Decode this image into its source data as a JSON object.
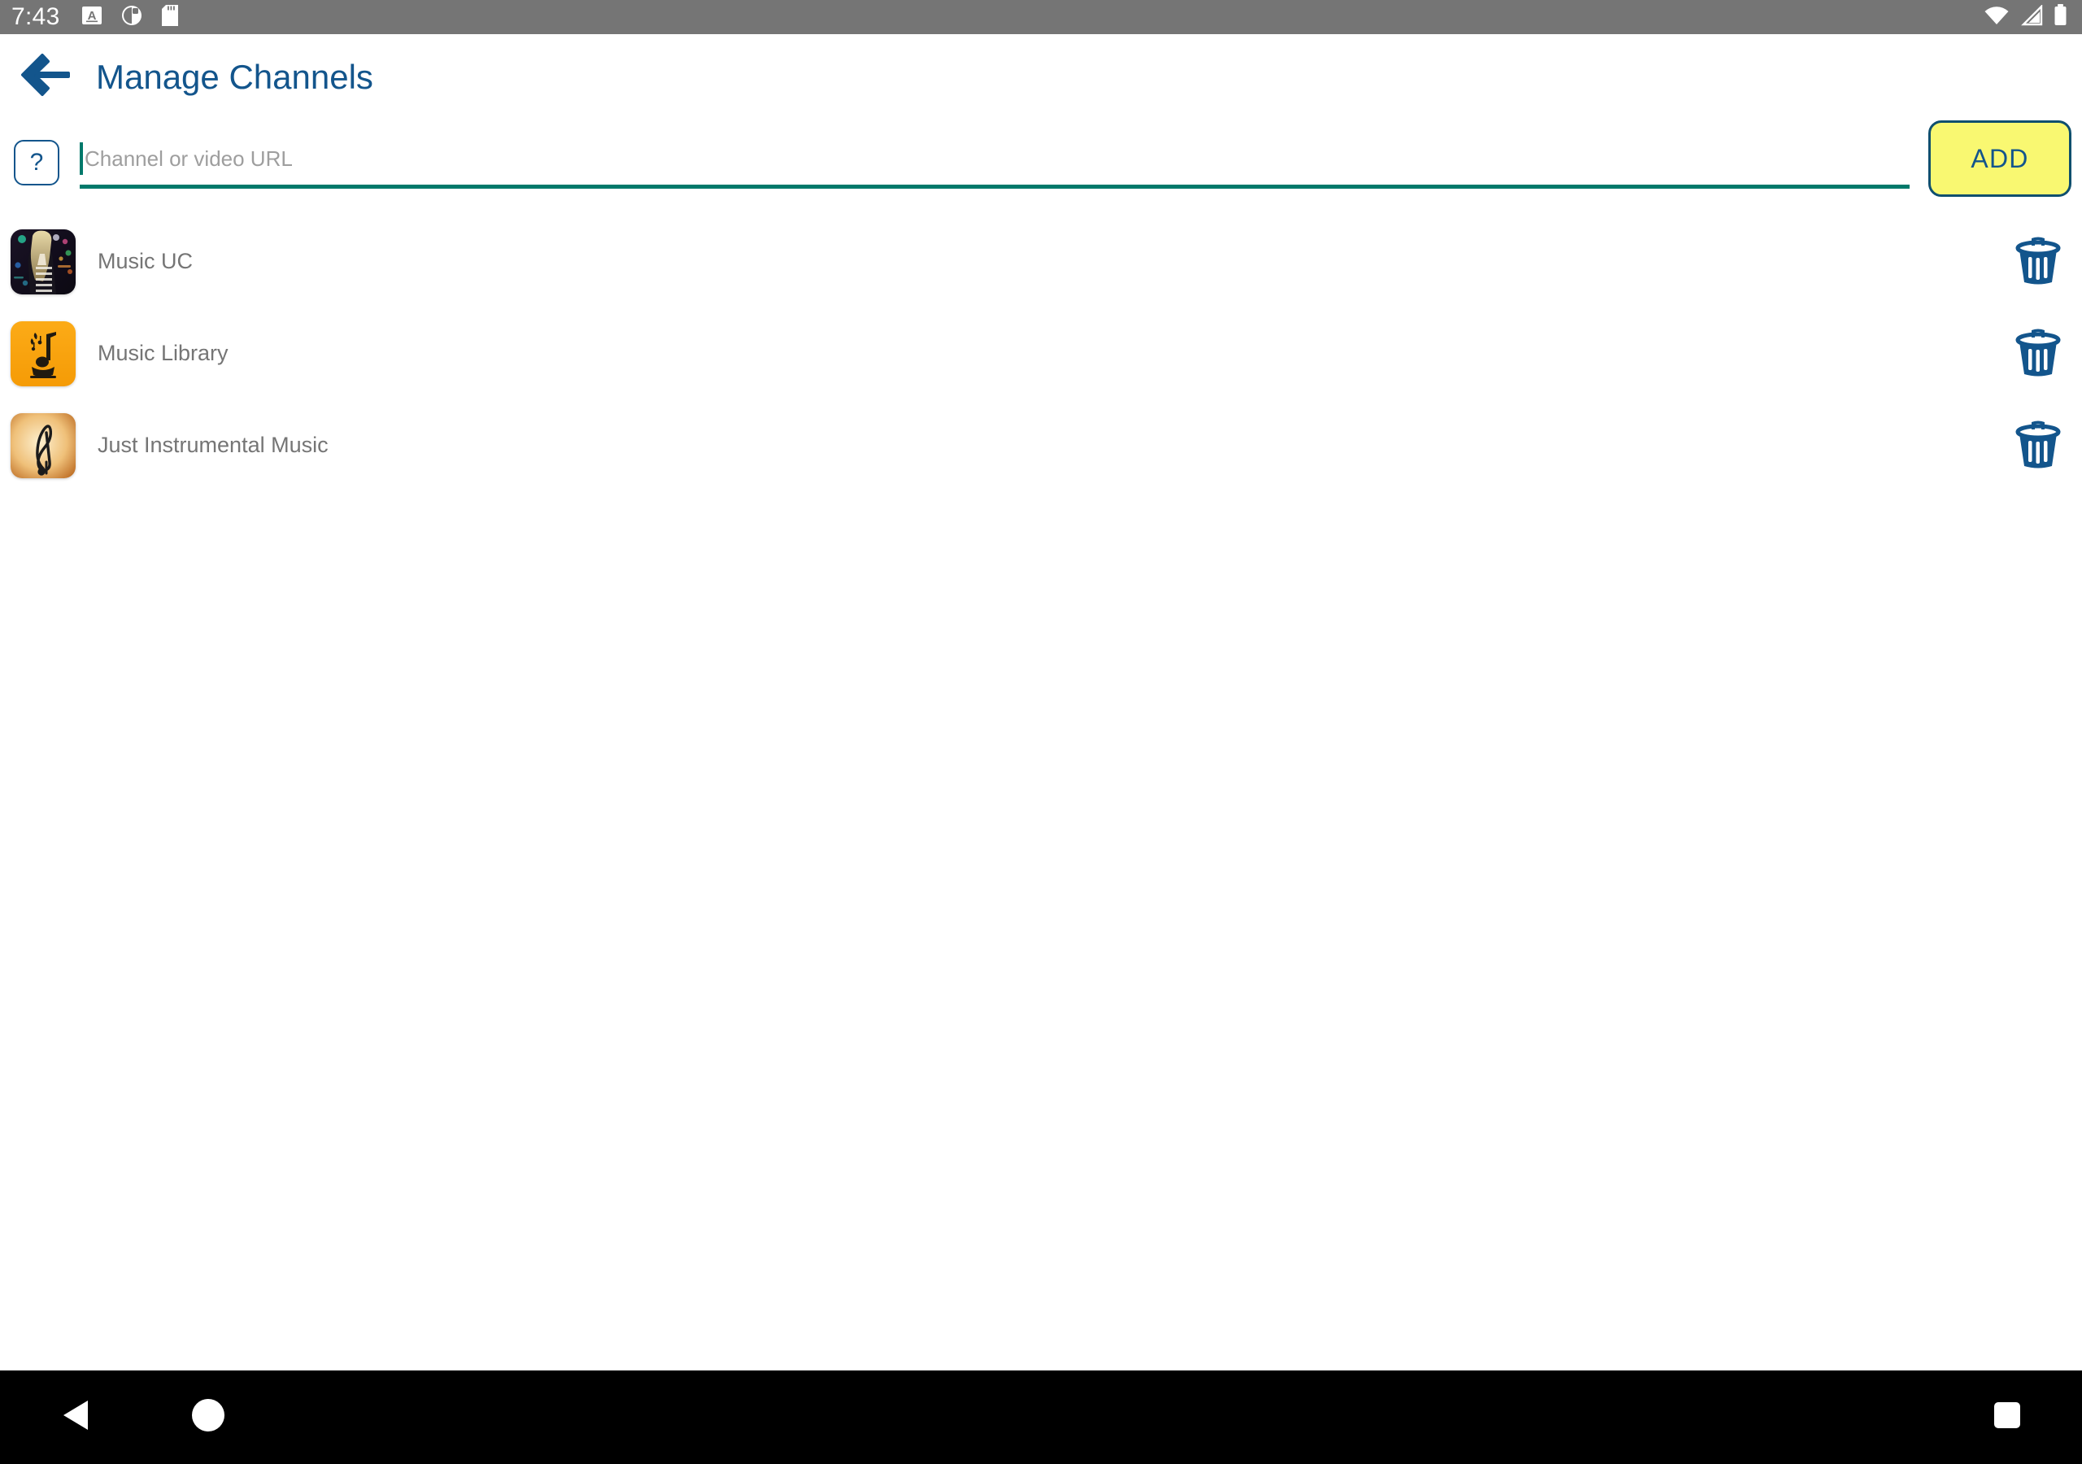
{
  "statusbar": {
    "time": "7:43",
    "left_icons": [
      {
        "name": "caption-a-icon",
        "label": "A"
      },
      {
        "name": "do-not-disturb-icon",
        "label": ""
      },
      {
        "name": "sd-card-icon",
        "label": ""
      }
    ],
    "right_icons": [
      {
        "name": "wifi-icon",
        "label": ""
      },
      {
        "name": "cellular-signal-icon",
        "label": ""
      },
      {
        "name": "battery-icon",
        "label": ""
      }
    ],
    "background_color": "#757575",
    "foreground_color": "#ffffff"
  },
  "titlebar": {
    "back_label": "",
    "title": "Manage Channels",
    "title_color": "#13558c"
  },
  "input_row": {
    "help_label": "?",
    "help_color": "#13558c",
    "url_value": "",
    "url_placeholder": "Channel or video URL",
    "underline_color": "#00796b",
    "add_label": "ADD",
    "add_background": "#f9f871",
    "add_text_color": "#13558c",
    "add_border_color": "#0f4f6e"
  },
  "channels": [
    {
      "name": "Music UC",
      "thumbnail": "night-lights-portrait-thumbnail",
      "delete_icon": "trash-icon"
    },
    {
      "name": "Music Library",
      "thumbnail": "orange-gramophone-note-thumbnail",
      "delete_icon": "trash-icon"
    },
    {
      "name": "Just Instrumental Music",
      "thumbnail": "sepia-treble-clef-thumbnail",
      "delete_icon": "trash-icon"
    }
  ],
  "navbar": {
    "back_label": "",
    "home_label": "",
    "recents_label": "",
    "background_color": "#000000"
  },
  "theme": {
    "accent_blue": "#13558c",
    "accent_teal": "#00796b",
    "accent_yellow": "#f9f871",
    "text_gray": "#757575",
    "placeholder_gray": "#9e9e9e"
  }
}
